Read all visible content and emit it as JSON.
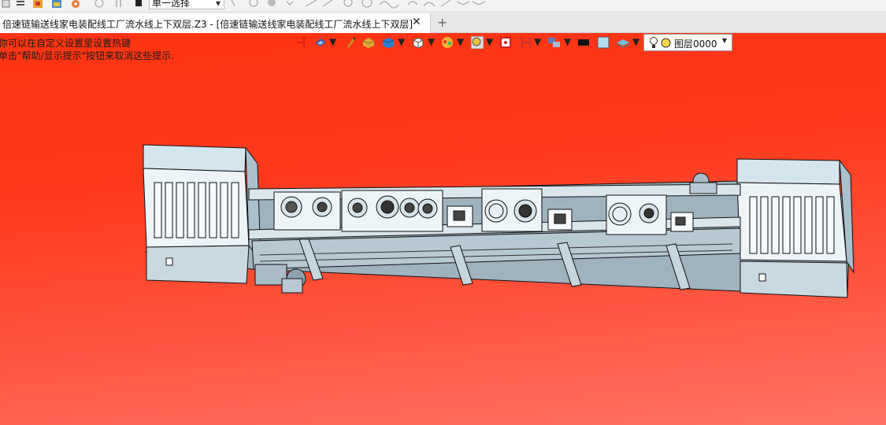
{
  "toolbar": {
    "selection_mode": "单一选择"
  },
  "tabs": [
    {
      "label": "倍速链输送线家电装配线工厂流水线上下双层.Z3 - [倍速链输送线家电装配线工厂流水线上下双层]"
    }
  ],
  "viewport": {
    "hints": [
      "你可以在自定义设置里设置热键",
      "单击\"帮助/显示提示\"按钮来取消这些提示."
    ],
    "layer": "图层0000",
    "background_colors": [
      "#ff3311",
      "#ff7266"
    ]
  },
  "icons": [
    "new-icon",
    "open-icon",
    "save-icon",
    "print-icon",
    "options-icon",
    "undo-icon",
    "redo-icon",
    "select-filter-icon",
    "datum-icon",
    "view-orientation-icon",
    "pen-icon",
    "solid-shade-icon",
    "box-view-icon",
    "cube-icon",
    "render-mode-icon",
    "zoom-icon",
    "fit-icon",
    "section-icon",
    "display-filter-icon",
    "color-swatch-icon",
    "fill-swatch-icon",
    "layer-stack-icon",
    "lightbulb-icon"
  ]
}
